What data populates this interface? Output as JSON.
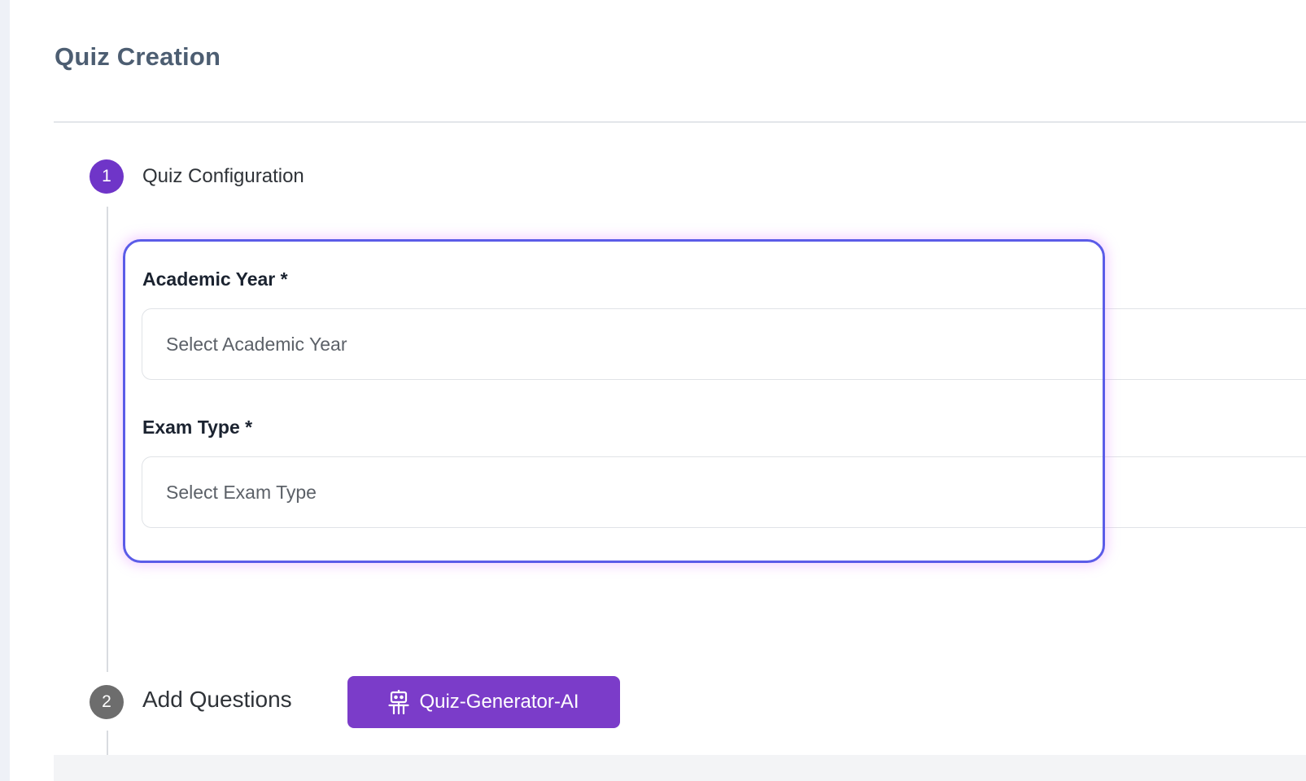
{
  "page": {
    "title": "Quiz Creation"
  },
  "steps": [
    {
      "number": "1",
      "label": "Quiz Configuration",
      "state": "active",
      "color": "#6f35c8"
    },
    {
      "number": "2",
      "label": "Add Questions",
      "state": "inactive",
      "color": "#6d6d6d"
    }
  ],
  "form": {
    "academic_year": {
      "label": "Academic Year *",
      "placeholder": "Select Academic Year"
    },
    "exam_type": {
      "label": "Exam Type *",
      "placeholder": "Select Exam Type"
    }
  },
  "ai_button": {
    "label": "Quiz-Generator-AI",
    "icon": "robot-icon",
    "color": "#7b3cc9"
  },
  "highlight": {
    "color": "#5b5ce8"
  }
}
